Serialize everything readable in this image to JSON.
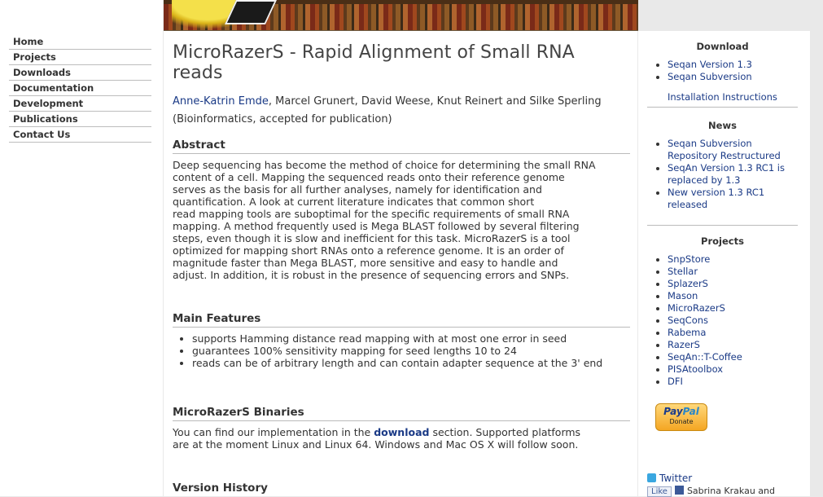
{
  "nav": {
    "items": [
      {
        "label": "Home"
      },
      {
        "label": "Projects"
      },
      {
        "label": "Downloads"
      },
      {
        "label": "Documentation"
      },
      {
        "label": "Development"
      },
      {
        "label": "Publications"
      },
      {
        "label": "Contact Us"
      }
    ]
  },
  "main": {
    "title": "MicroRazerS - Rapid Alignment of Small RNA reads",
    "author_link": "Anne-Katrin Emde",
    "authors_rest": ", Marcel Grunert, David Weese, Knut Reinert and Silke Sperling",
    "journal": "(Bioinformatics, accepted for publication)",
    "abstract_heading": "Abstract",
    "abstract_lines": [
      "Deep sequencing has become the method of choice for determining the small RNA",
      "content of a cell. Mapping the sequenced reads onto their reference genome",
      "serves as the basis for all further analyses, namely for identification and",
      "quantification. A look at current literature indicates that common short",
      "read mapping tools are suboptimal for the specific requirements of small RNA",
      "mapping. A method frequently used is Mega BLAST followed by several filtering",
      "steps, even though it is slow and inefficient for this task. MicroRazerS is a tool",
      "optimized for mapping short RNAs onto a reference genome. It is an order of",
      "magnitude faster than Mega BLAST, more sensitive and easy to handle and",
      "adjust. In addition, it is robust in the presence of sequencing errors and SNPs."
    ],
    "features_heading": "Main Features",
    "features": [
      "supports Hamming distance read mapping with at most one error in seed",
      "guarantees 100% sensitivity mapping for seed lengths 10 to 24",
      "reads can be of arbitrary length and can contain adapter sequence at the 3' end"
    ],
    "binaries_heading": "MicroRazerS Binaries",
    "binaries_pre": "You can find our implementation in the ",
    "binaries_link": "download",
    "binaries_post": " section. Supported platforms",
    "binaries_line2": "are at the moment Linux and Linux 64. Windows and Mac OS X will follow soon.",
    "history_heading": "Version History"
  },
  "sidebar": {
    "download_title": "Download",
    "download_items": [
      "Seqan Version 1.3",
      "Seqan Subversion"
    ],
    "install_link": "Installation Instructions",
    "news_title": "News",
    "news_items": [
      "Seqan Subversion Repository Restructured",
      "SeqAn Version 1.3 RC1 is replaced by 1.3",
      "New version 1.3 RC1 released"
    ],
    "projects_title": "Projects",
    "projects_items": [
      "SnpStore",
      "Stellar",
      "SplazerS",
      "Mason",
      "MicroRazerS",
      "SeqCons",
      "Rabema",
      "RazerS",
      "SeqAn::T-Coffee",
      "PISAtoolbox",
      "DFI"
    ],
    "paypal_brand_a": "Pay",
    "paypal_brand_b": "Pal",
    "paypal_donate": "Donate",
    "twitter": "Twitter",
    "like": "Like",
    "fb_text": "Sabrina Krakau and"
  }
}
